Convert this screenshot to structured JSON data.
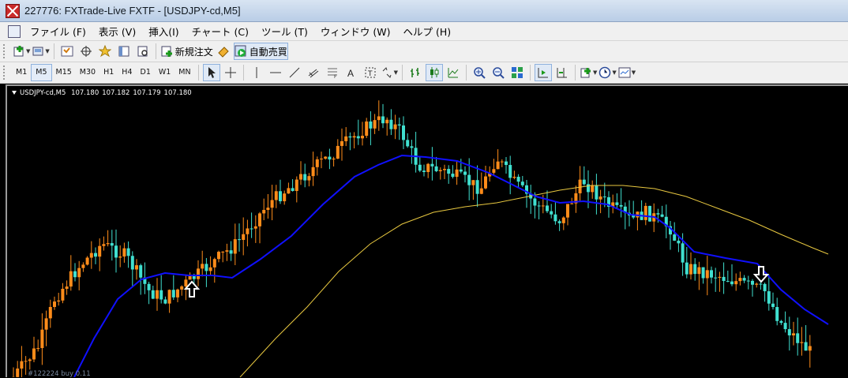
{
  "window": {
    "title": "227776: FXTrade-Live FXTF - [USDJPY-cd,M5]"
  },
  "menu": {
    "items": [
      "ファイル (F)",
      "表示 (V)",
      "挿入(I)",
      "チャート (C)",
      "ツール (T)",
      "ウィンドウ (W)",
      "ヘルプ (H)"
    ]
  },
  "toolbar": {
    "new_order_label": "新規注文",
    "auto_trade_label": "自動売買"
  },
  "timeframes": [
    "M1",
    "M5",
    "M15",
    "M30",
    "H1",
    "H4",
    "D1",
    "W1",
    "MN"
  ],
  "active_timeframe": "M5",
  "chart": {
    "symbol_tf": "USDJPY-cd,M5",
    "open": "107.180",
    "high": "107.182",
    "low": "107.179",
    "close": "107.180",
    "bottom_label": "#122224 buy 0.11",
    "colors": {
      "bull": "#ff8c1a",
      "bear": "#40e0d0",
      "ma_fast": "#1010ff",
      "ma_slow": "#e8c840",
      "background": "#000000"
    },
    "arrows": {
      "up": "up-arrow-signal",
      "down": "down-arrow-signal"
    }
  }
}
